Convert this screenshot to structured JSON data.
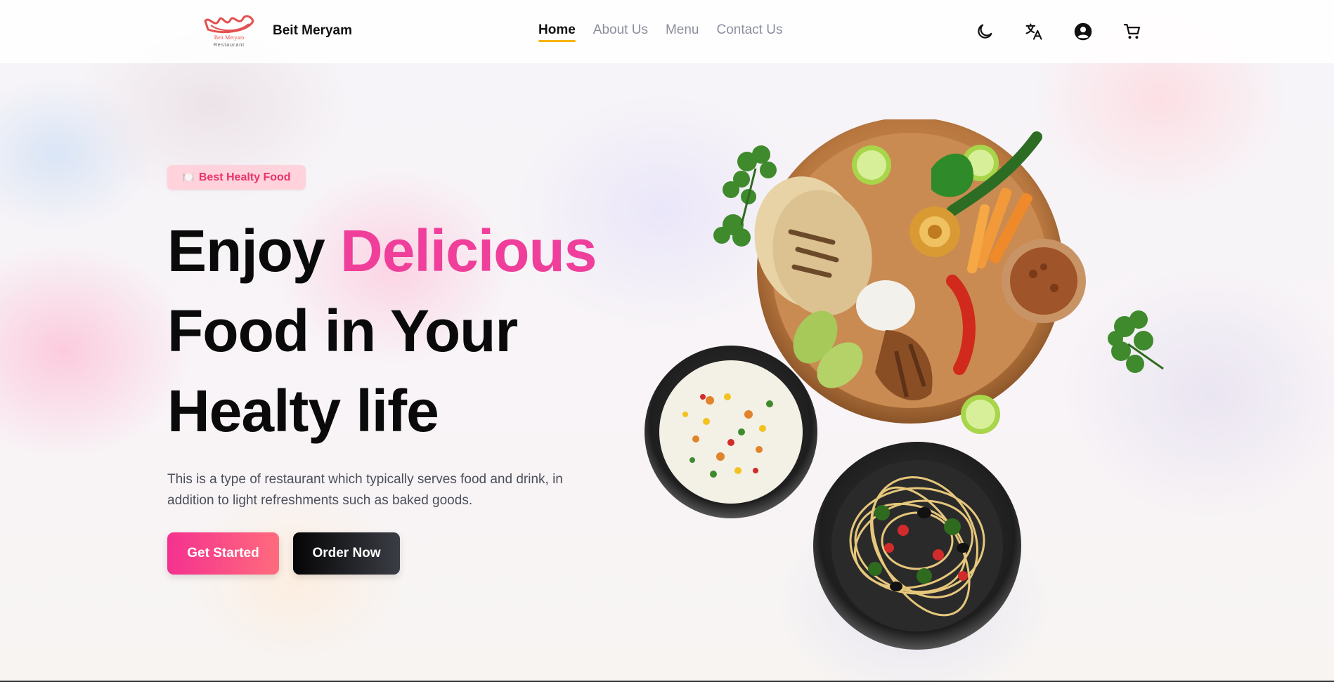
{
  "nav": {
    "logo_text": "Beit Meryam Restaurant",
    "brand": "Beit Meryam",
    "links": [
      {
        "label": "Home",
        "active": true
      },
      {
        "label": "About Us",
        "active": false
      },
      {
        "label": "Menu",
        "active": false
      },
      {
        "label": "Contact Us",
        "active": false
      }
    ],
    "icons": [
      "moon-icon",
      "translate-icon",
      "account-icon",
      "cart-icon"
    ]
  },
  "hero": {
    "badge_icon": "🍽️",
    "badge_label": "Best Healty Food",
    "headline_part1": "Enjoy ",
    "headline_highlight": "Delicious",
    "headline_line2": "Food in Your",
    "headline_line3": "Healty life",
    "description": "This is a type of restaurant which typically serves food and drink, in addition to light refreshments such as baked goods.",
    "primary_button": "Get Started",
    "secondary_button": "Order Now"
  },
  "colors": {
    "accent_pink": "#ef3f9b",
    "active_underline": "#f6b40b",
    "badge_bg": "#ffd2dc",
    "badge_text": "#e8356b"
  }
}
